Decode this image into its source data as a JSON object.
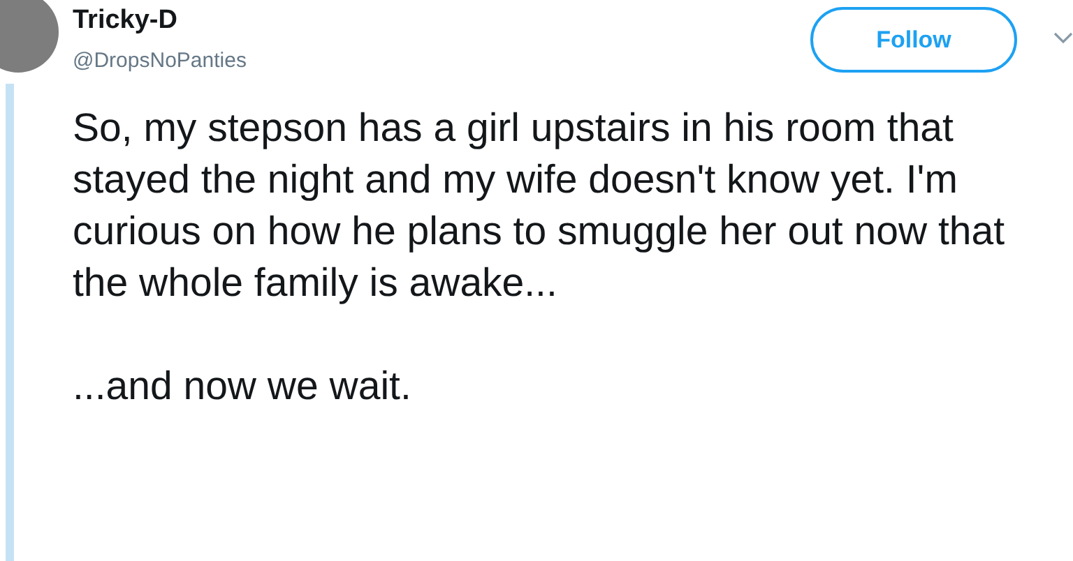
{
  "author": {
    "name": "Tricky-D",
    "handle": "@DropsNoPanties"
  },
  "follow_button": {
    "label": "Follow"
  },
  "tweet": {
    "paragraphs": [
      "So, my stepson has a girl upstairs in his room that stayed the night and my wife doesn't know yet. I'm curious on how he plans to smuggle her out now that the whole family is awake...",
      "...and now we wait."
    ]
  }
}
